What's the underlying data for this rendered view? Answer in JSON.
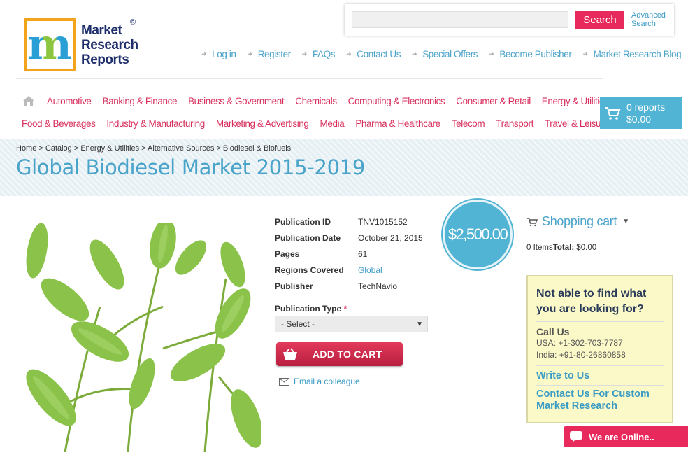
{
  "logo": {
    "line1": "Market",
    "line2": "Research",
    "line3": "Reports",
    "reg": "®"
  },
  "search": {
    "placeholder": "",
    "button": "Search",
    "advanced_line1": "Advanced",
    "advanced_line2": "Search"
  },
  "toplinks": [
    "Log in",
    "Register",
    "FAQs",
    "Contact Us",
    "Special Offers",
    "Become Publisher",
    "Market Research Blog"
  ],
  "categories_row1": [
    "Automotive",
    "Banking & Finance",
    "Business & Government",
    "Chemicals",
    "Computing & Electronics",
    "Consumer & Retail",
    "Energy & Utilities"
  ],
  "categories_row2": [
    "Food & Beverages",
    "Industry & Manufacturing",
    "Marketing & Advertising",
    "Media",
    "Pharma & Healthcare",
    "Telecom",
    "Transport",
    "Travel & Leisure"
  ],
  "cart_box": {
    "reports": "0 reports",
    "amount": "$0.00"
  },
  "breadcrumb": "Home > Catalog > Energy & Utilities > Alternative Sources > Biodiesel & Biofuels",
  "title": "Global Biodiesel Market 2015-2019",
  "details": {
    "pub_id_label": "Publication ID",
    "pub_id": "TNV1015152",
    "pub_date_label": "Publication Date",
    "pub_date": "October 21, 2015",
    "pages_label": "Pages",
    "pages": "61",
    "regions_label": "Regions Covered",
    "regions": "Global",
    "publisher_label": "Publisher",
    "publisher": "TechNavio"
  },
  "price": "$2,500.00",
  "pub_type": {
    "label": "Publication Type",
    "required": "*",
    "selected": "- Select -"
  },
  "add_to_cart": "ADD TO CART",
  "email_colleague": "Email a colleague",
  "sidebar": {
    "cart_title": "Shopping cart",
    "items": "0 Items",
    "total_label": "Total:",
    "total": "$0.00",
    "help_title": "Not able to find what you are looking for?",
    "call_us": "Call Us",
    "usa": "USA: +1-302-703-7787",
    "india": "India: +91-80-26860858",
    "write": "Write to Us",
    "custom": "Contact Us For Custom Market Research"
  },
  "online": "We are Online..",
  "colors": {
    "accent_pink": "#e8295c",
    "accent_blue": "#52b4d4",
    "link_blue": "#4aa3c9"
  }
}
